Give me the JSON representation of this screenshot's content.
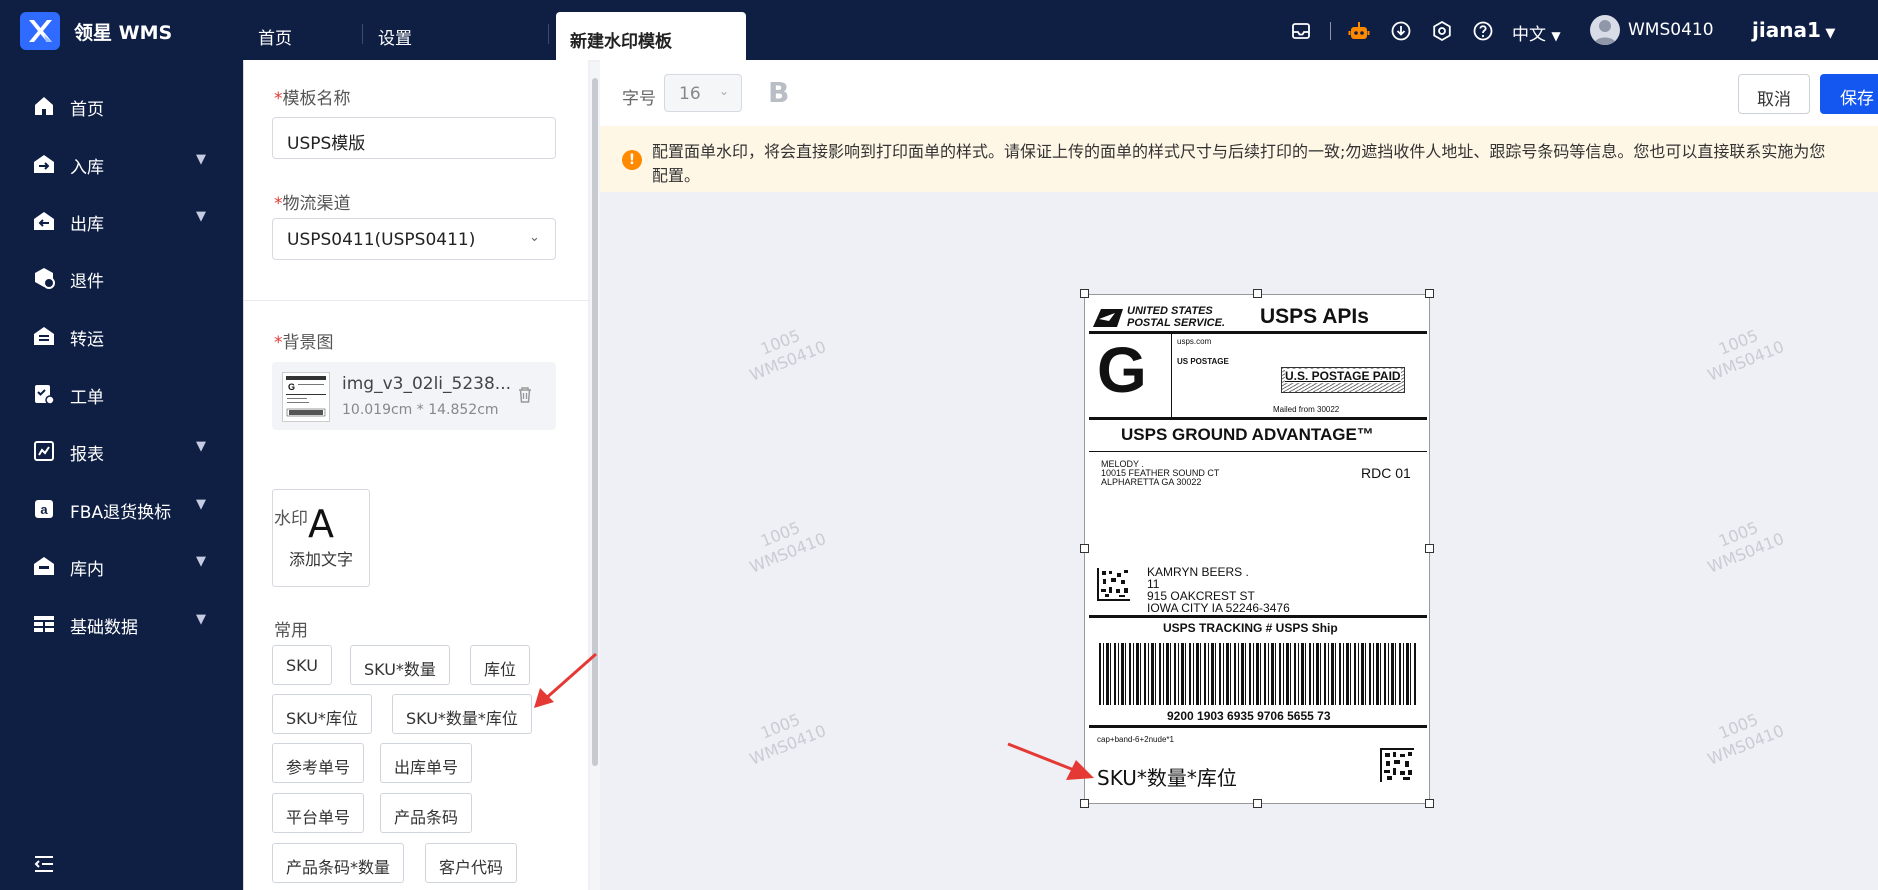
{
  "header": {
    "app_title": "领星 WMS",
    "tabs": [
      {
        "label": "首页"
      },
      {
        "label": "设置"
      }
    ],
    "active_tab": "新建水印模板",
    "language": "中文",
    "user_id": "WMS0410",
    "user_name": "jiana1"
  },
  "sidebar": {
    "items": [
      {
        "label": "首页",
        "icon": "home-icon",
        "expandable": false
      },
      {
        "label": "入库",
        "icon": "inbound-icon",
        "expandable": true
      },
      {
        "label": "出库",
        "icon": "outbound-icon",
        "expandable": true
      },
      {
        "label": "退件",
        "icon": "return-icon",
        "expandable": false
      },
      {
        "label": "转运",
        "icon": "transfer-icon",
        "expandable": false
      },
      {
        "label": "工单",
        "icon": "work-order-icon",
        "expandable": false
      },
      {
        "label": "报表",
        "icon": "report-icon",
        "expandable": true
      },
      {
        "label": "FBA退货换标",
        "icon": "fba-icon",
        "expandable": true
      },
      {
        "label": "库内",
        "icon": "warehouse-icon",
        "expandable": true
      },
      {
        "label": "基础数据",
        "icon": "data-icon",
        "expandable": true
      }
    ]
  },
  "form": {
    "template_name_label": "模板名称",
    "template_name_value": "USPS模版",
    "channel_label": "物流渠道",
    "channel_value": "USPS0411(USPS0411)",
    "background_label": "背景图",
    "file_name": "img_v3_02li_5238...",
    "file_size": "10.019cm * 14.852cm",
    "watermark_label": "水印",
    "add_text_glyph": "A",
    "add_text_label": "添加文字",
    "common_label": "常用",
    "chips": [
      "SKU",
      "SKU*数量",
      "库位",
      "SKU*库位",
      "SKU*数量*库位",
      "参考单号",
      "出库单号",
      "平台单号",
      "产品条码",
      "产品条码*数量",
      "客户代码"
    ]
  },
  "toolbar": {
    "font_size_label": "字号",
    "font_size_value": "16",
    "bold_label": "B",
    "cancel_label": "取消",
    "save_label": "保存"
  },
  "notice": {
    "line1": "配置面单水印，将会直接影响到打印面单的样式。请保证上传的面单的样式尺寸与后续打印的一致;勿遮挡收件人地址、跟踪号条码等信息。您也可以直接联系实施为您",
    "line2": "配置。"
  },
  "watermark_bg": {
    "line1": "1005",
    "line2": "WMS0410"
  },
  "label": {
    "brand_line1": "UNITED STATES",
    "brand_line2": "POSTAL SERVICE.",
    "apis_title": "USPS APIs",
    "big_letter": "G",
    "usps_com": "usps.com",
    "us_postage": "US POSTAGE",
    "postage_paid": "U.S. POSTAGE PAID",
    "mailed_from": "Mailed from 30022",
    "service": "USPS GROUND ADVANTAGE™",
    "sender_line1": "MELODY .",
    "sender_line2": "10015 FEATHER SOUND CT",
    "sender_line3": "ALPHARETTA GA 30022",
    "rdc": "RDC 01",
    "recipient_line1": "KAMRYN BEERS .",
    "recipient_line2": "11",
    "recipient_line3": "915 OAKCREST ST",
    "recipient_line4": "IOWA CITY IA 52246-3476",
    "tracking_title": "USPS TRACKING # USPS Ship",
    "tracking_number": "9200 1903 6935 9706 5655 73",
    "footer_small": "cap+band-6+2nude*1",
    "watermark_text": "SKU*数量*库位"
  }
}
